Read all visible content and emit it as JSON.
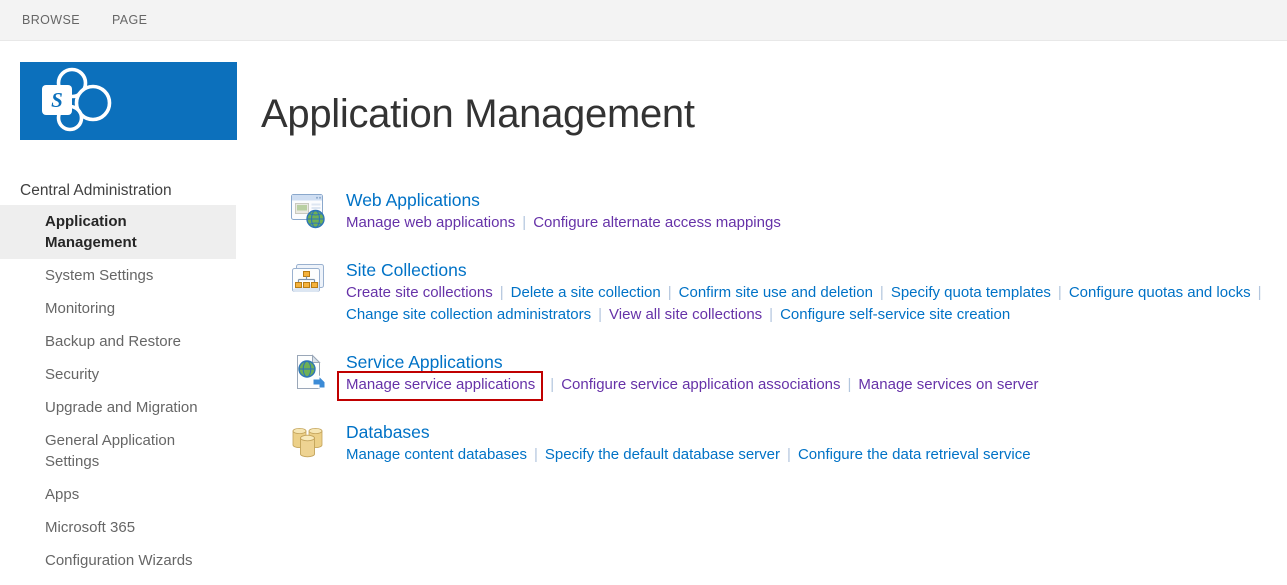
{
  "ui": {
    "separator": "|"
  },
  "theme": {
    "suite_blue": "#0c70bc",
    "link_blue": "#0072c6",
    "visited_purple": "#6632a8",
    "highlight_red": "#c00000",
    "topbar_bg": "#f3f3f3",
    "selected_item_bg": "#eeeeee"
  },
  "topbar": {
    "tabs": [
      {
        "label": "BROWSE"
      },
      {
        "label": "PAGE"
      }
    ]
  },
  "header": {
    "logo": "sharepoint-logo",
    "logo_letter": "S",
    "title": "Application Management"
  },
  "sidebar": {
    "root": "Central Administration",
    "items": [
      {
        "label": "Application Management",
        "selected": true
      },
      {
        "label": "System Settings",
        "selected": false
      },
      {
        "label": "Monitoring",
        "selected": false
      },
      {
        "label": "Backup and Restore",
        "selected": false
      },
      {
        "label": "Security",
        "selected": false
      },
      {
        "label": "Upgrade and Migration",
        "selected": false
      },
      {
        "label": "General Application Settings",
        "selected": false
      },
      {
        "label": "Apps",
        "selected": false
      },
      {
        "label": "Microsoft 365",
        "selected": false
      },
      {
        "label": "Configuration Wizards",
        "selected": false
      }
    ]
  },
  "sections": [
    {
      "icon": "web-applications-icon",
      "title": "Web Applications",
      "rows": [
        [
          {
            "label": "Manage web applications",
            "visited": true
          },
          {
            "label": "Configure alternate access mappings",
            "visited": true
          }
        ]
      ]
    },
    {
      "icon": "site-collections-icon",
      "title": "Site Collections",
      "rows": [
        [
          {
            "label": "Create site collections",
            "visited": true
          },
          {
            "label": "Delete a site collection",
            "visited": false
          },
          {
            "label": "Confirm site use and deletion",
            "visited": false
          },
          {
            "label": "Specify quota templates",
            "visited": false
          },
          {
            "label": "Configure quotas and locks",
            "visited": false
          }
        ],
        [
          {
            "label": "Change site collection administrators",
            "visited": false
          },
          {
            "label": "View all site collections",
            "visited": true
          },
          {
            "label": "Configure self-service site creation",
            "visited": false
          }
        ]
      ]
    },
    {
      "icon": "service-applications-icon",
      "title": "Service Applications",
      "rows": [
        [
          {
            "label": "Manage service applications",
            "visited": true,
            "highlighted": true
          },
          {
            "label": "Configure service application associations",
            "visited": true
          },
          {
            "label": "Manage services on server",
            "visited": true
          }
        ]
      ]
    },
    {
      "icon": "databases-icon",
      "title": "Databases",
      "rows": [
        [
          {
            "label": "Manage content databases",
            "visited": false
          },
          {
            "label": "Specify the default database server",
            "visited": false
          },
          {
            "label": "Configure the data retrieval service",
            "visited": false
          }
        ]
      ]
    }
  ]
}
